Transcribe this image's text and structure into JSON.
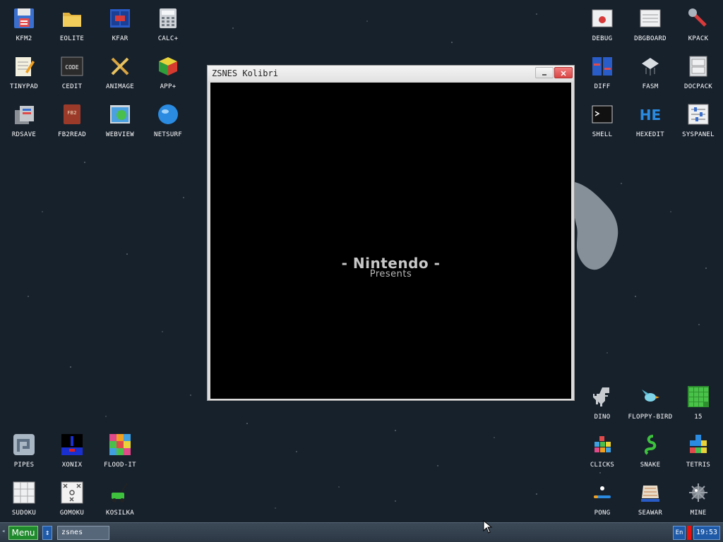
{
  "desktop": {
    "icons_left": [
      {
        "label": "KFM2"
      },
      {
        "label": "EOLITE"
      },
      {
        "label": "KFAR"
      },
      {
        "label": "CALC+"
      },
      {
        "label": "TINYPAD"
      },
      {
        "label": "CEDIT"
      },
      {
        "label": "ANIMAGE"
      },
      {
        "label": "APP+"
      },
      {
        "label": "RDSAVE"
      },
      {
        "label": "FB2READ"
      },
      {
        "label": "WEBVIEW"
      },
      {
        "label": "NETSURF"
      },
      {
        "label": "PIPES"
      },
      {
        "label": "XONIX"
      },
      {
        "label": "FLOOD-IT"
      },
      {
        "label": "SUDOKU"
      },
      {
        "label": "GOMOKU"
      },
      {
        "label": "KOSILKA"
      }
    ],
    "icons_right": [
      {
        "label": "DEBUG"
      },
      {
        "label": "DBGBOARD"
      },
      {
        "label": "KPACK"
      },
      {
        "label": "DIFF"
      },
      {
        "label": "FASM"
      },
      {
        "label": "DOCPACK"
      },
      {
        "label": "SHELL"
      },
      {
        "label": "HEXEDIT"
      },
      {
        "label": "SYSPANEL"
      },
      {
        "label": "DINO"
      },
      {
        "label": "FLOPPY-BIRD"
      },
      {
        "label": "15"
      },
      {
        "label": "CLICKS"
      },
      {
        "label": "SNAKE"
      },
      {
        "label": "TETRIS"
      },
      {
        "label": "PONG"
      },
      {
        "label": "SEAWAR"
      },
      {
        "label": "MINE"
      }
    ],
    "icon_text": {
      "cedit": "CODE",
      "fb2read": "FB2",
      "hexedit": "HE"
    }
  },
  "window": {
    "title": "ZSNES Kolibri",
    "minimize_glyph": "–",
    "close_glyph": "×",
    "screen_line1": "- Nintendo -",
    "screen_line2": "Presents"
  },
  "taskbar": {
    "left_arrow": "◂",
    "menu_label": "Menu",
    "scroll_glyph": "↕",
    "task_label": "zsnes",
    "lang": "En",
    "time": "19:53"
  },
  "colors": {
    "desktop_bg": "#17212c",
    "menu_green": "#1f8a2c",
    "tray_blue": "#1e5aa8",
    "close_red": "#d94646"
  }
}
